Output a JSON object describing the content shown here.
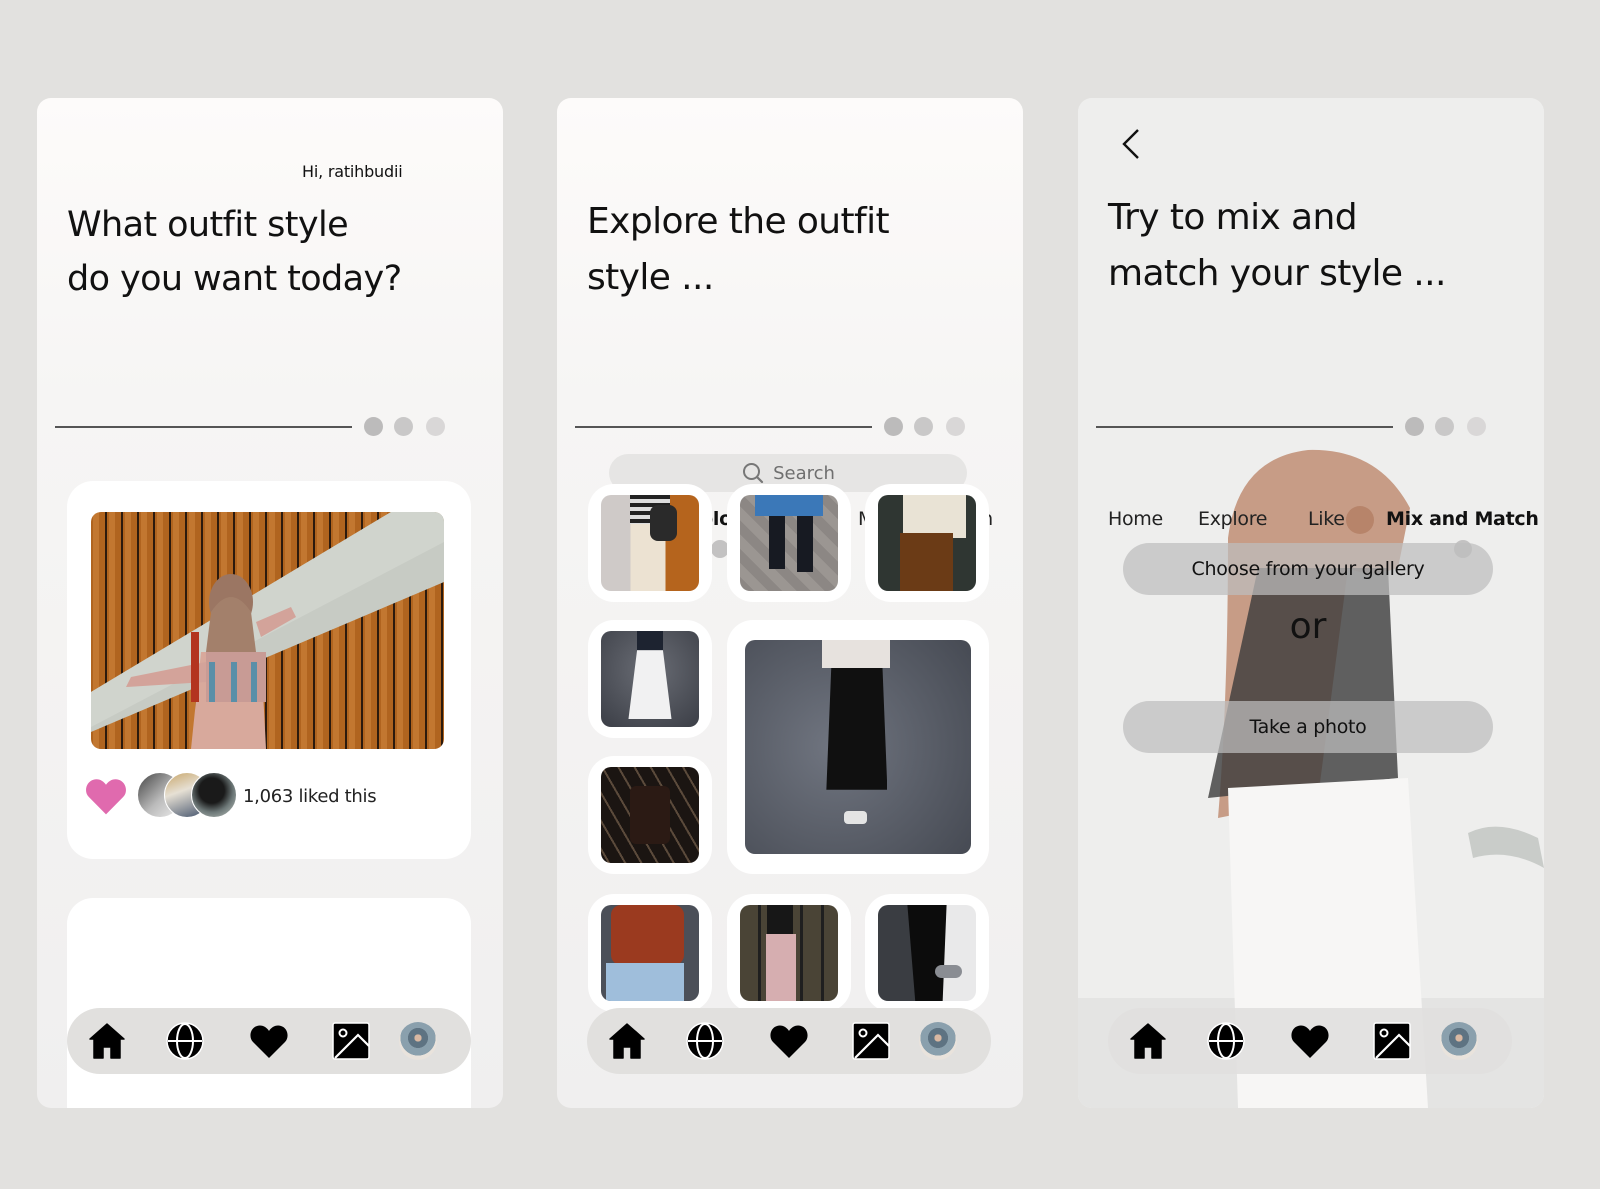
{
  "colors": {
    "page_background": "#e2e1df",
    "screen_background": "#f4f3f2",
    "nav_background": "#e1e0de",
    "like_heart": "#e06aae",
    "pager_dots": [
      "#bcbbbb",
      "#c9c8c8",
      "#d9d7d7"
    ],
    "indicator": "#c3c2c2"
  },
  "tabs": [
    "Home",
    "Explore",
    "Like",
    "Mix and Match"
  ],
  "bottom_nav": [
    {
      "icon": "home-icon",
      "label": "Home"
    },
    {
      "icon": "globe-icon",
      "label": "Explore"
    },
    {
      "icon": "heart-icon",
      "label": "Like"
    },
    {
      "icon": "image-icon",
      "label": "Mix and Match"
    },
    {
      "icon": "avatar",
      "label": "Profile"
    }
  ],
  "screens": {
    "home": {
      "greeting": "Hi, ratihbudii",
      "headline": [
        "What outfit style",
        "do you want today?"
      ],
      "active_tab": "Home",
      "feed": [
        {
          "photo": "woman in patterned dress leaning on wooden wall",
          "likes_text": "1,063 liked this",
          "liked": true
        }
      ]
    },
    "explore": {
      "headline": [
        "Explore the outfit",
        "style ..."
      ],
      "search_placeholder": "Search",
      "active_tab": "Explore",
      "grid": [
        "striped top with cream trousers",
        "blue shirt with black trousers",
        "cream cardigan with brown trousers",
        "white midi skirt",
        "black skirt with white blouse",
        "patterned cardigan",
        "red sweater with blue jeans",
        "pink pleated skirt",
        "black trousers with grey sneakers"
      ]
    },
    "mix": {
      "headline": [
        "Try to mix and",
        "match your style ..."
      ],
      "active_tab": "Mix and Match",
      "gallery_button": "Choose from your gallery",
      "or_label": "or",
      "photo_button": "Take a photo"
    }
  }
}
